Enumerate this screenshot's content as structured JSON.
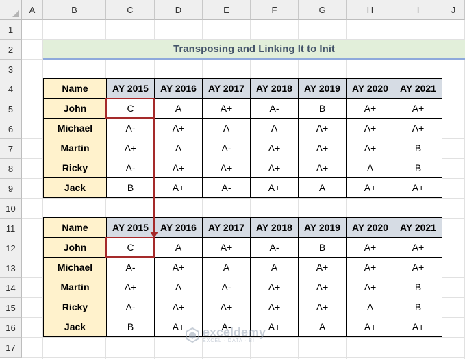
{
  "column_headers": [
    "A",
    "B",
    "C",
    "D",
    "E",
    "F",
    "G",
    "H",
    "I",
    "J"
  ],
  "row_headers": [
    "1",
    "2",
    "3",
    "4",
    "5",
    "6",
    "7",
    "8",
    "9",
    "10",
    "11",
    "12",
    "13",
    "14",
    "15",
    "16",
    "17"
  ],
  "title": "Transposing and Linking It to Init",
  "table_top": {
    "header": [
      "Name",
      "AY 2015",
      "AY 2016",
      "AY 2017",
      "AY 2018",
      "AY 2019",
      "AY 2020",
      "AY 2021"
    ],
    "rows": [
      [
        "John",
        "C",
        "A",
        "A+",
        "A-",
        "B",
        "A+",
        "A+"
      ],
      [
        "Michael",
        "A-",
        "A+",
        "A",
        "A",
        "A+",
        "A+",
        "A+"
      ],
      [
        "Martin",
        "A+",
        "A",
        "A-",
        "A+",
        "A+",
        "A+",
        "B"
      ],
      [
        "Ricky",
        "A-",
        "A+",
        "A+",
        "A+",
        "A+",
        "A",
        "B"
      ],
      [
        "Jack",
        "B",
        "A+",
        "A-",
        "A+",
        "A",
        "A+",
        "A+"
      ]
    ]
  },
  "table_bottom": {
    "header": [
      "Name",
      "AY 2015",
      "AY 2016",
      "AY 2017",
      "AY 2018",
      "AY 2019",
      "AY 2020",
      "AY 2021"
    ],
    "rows": [
      [
        "John",
        "C",
        "A",
        "A+",
        "A-",
        "B",
        "A+",
        "A+"
      ],
      [
        "Michael",
        "A-",
        "A+",
        "A",
        "A",
        "A+",
        "A+",
        "A+"
      ],
      [
        "Martin",
        "A+",
        "A",
        "A-",
        "A+",
        "A+",
        "A+",
        "B"
      ],
      [
        "Ricky",
        "A-",
        "A+",
        "A+",
        "A+",
        "A+",
        "A",
        "B"
      ],
      [
        "Jack",
        "B",
        "A+",
        "A-",
        "A+",
        "A",
        "A+",
        "A+"
      ]
    ]
  },
  "watermark": {
    "name": "exceldemy",
    "tagline": "EXCEL · DATA · BI",
    "icon": "exceldemy-logo-icon"
  },
  "colors": {
    "title_band": "#e2efda",
    "title_text": "#44546a",
    "name_fill": "#fff2cc",
    "year_fill": "#d6dce4",
    "highlight": "#a52a2a"
  }
}
